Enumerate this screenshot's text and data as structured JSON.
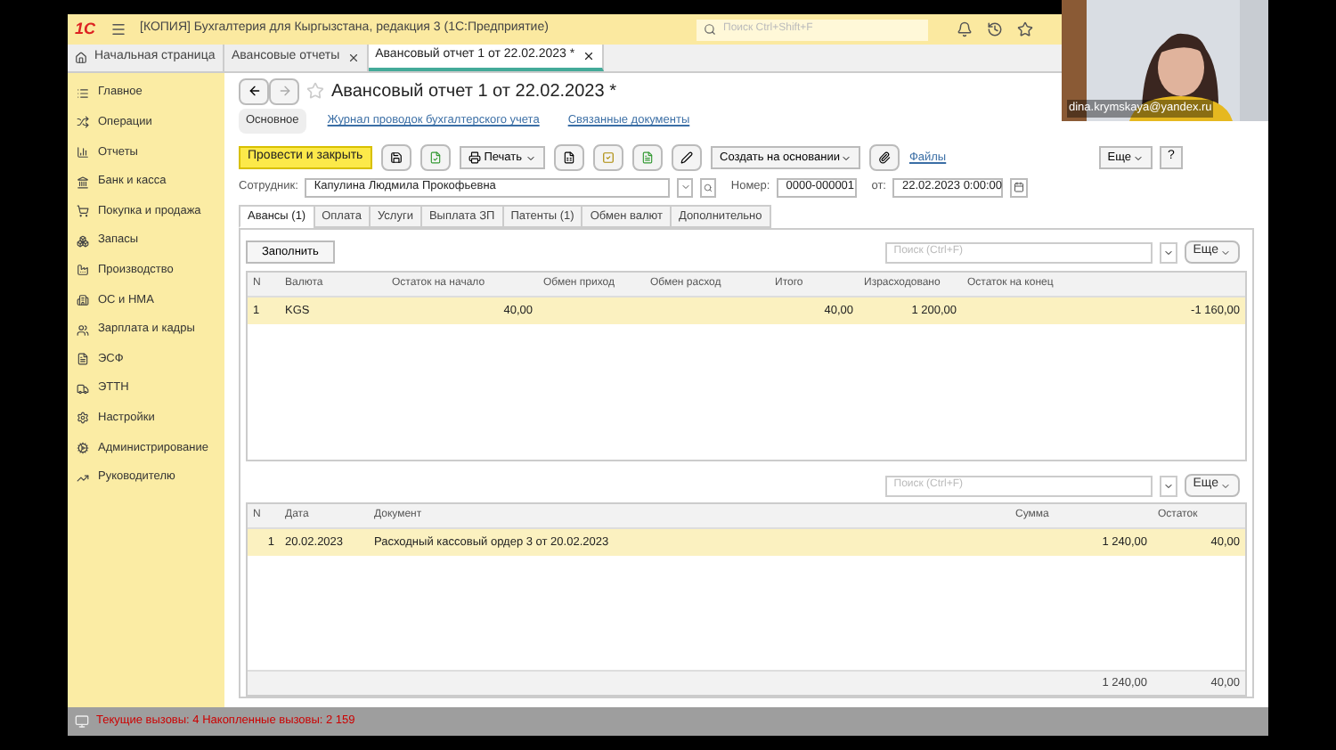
{
  "title_bar": {
    "logo": "1С",
    "title": "[КОПИЯ] Бухгалтерия для Кыргызстана, редакция 3  (1С:Предприятие)",
    "search": {
      "placeholder": "Поиск Ctrl+Shift+F"
    }
  },
  "tabs": [
    {
      "label": "Начальная страница",
      "selected": false,
      "kind": "home"
    },
    {
      "label": "Авансовые отчеты",
      "selected": false,
      "kind": "doc"
    },
    {
      "label": "Авансовый отчет 1 от 22.02.2023 *",
      "selected": true,
      "kind": "doc"
    }
  ],
  "sidebar": {
    "items": [
      {
        "label": "Главное"
      },
      {
        "label": "Операции"
      },
      {
        "label": "Отчеты"
      },
      {
        "label": "Банк и касса"
      },
      {
        "label": "Покупка и продажа"
      },
      {
        "label": "Запасы"
      },
      {
        "label": "Производство"
      },
      {
        "label": "ОС и НМА"
      },
      {
        "label": "Зарплата и кадры"
      },
      {
        "label": "ЭСФ"
      },
      {
        "label": "ЭТТН"
      },
      {
        "label": "Настройки"
      },
      {
        "label": "Администрирование"
      },
      {
        "label": "Руководителю"
      }
    ]
  },
  "document": {
    "title": "Авансовый отчет 1 от 22.02.2023 *",
    "sections": [
      {
        "label": "Основное",
        "selected": true
      },
      {
        "label": "Журнал проводок бухгалтерского учета",
        "selected": false
      },
      {
        "label": "Связанные документы",
        "selected": false
      }
    ],
    "toolbar": {
      "post_close": "Провести и закрыть",
      "print": "Печать",
      "create_based": "Создать на основании",
      "files": "Файлы",
      "more": "Еще",
      "help": "?"
    },
    "fields": {
      "employee_label": "Сотрудник:",
      "employee": "Капулина Людмила Прокофьевна",
      "number_label": "Номер:",
      "number": "0000-000001",
      "date_label": "от:",
      "date": "22.02.2023  0:00:00"
    },
    "tabs": [
      {
        "label": "Авансы (1)",
        "selected": true
      },
      {
        "label": "Оплата",
        "selected": false
      },
      {
        "label": "Услуги",
        "selected": false
      },
      {
        "label": "Выплата ЗП",
        "selected": false
      },
      {
        "label": "Патенты (1)",
        "selected": false
      },
      {
        "label": "Обмен валют",
        "selected": false
      },
      {
        "label": "Дополнительно",
        "selected": false
      }
    ],
    "advances": {
      "fill_button": "Заполнить",
      "search": {
        "placeholder": "Поиск (Ctrl+F)"
      },
      "more": "Еще",
      "columns": [
        "N",
        "Валюта",
        "Остаток на начало",
        "Обмен приход",
        "Обмен расход",
        "Итого",
        "Израсходовано",
        "Остаток на конец"
      ],
      "rows": [
        {
          "selected": true,
          "cells": [
            "1",
            "KGS",
            "40,00",
            "",
            "",
            "40,00",
            "1 200,00",
            "-1 160,00"
          ]
        }
      ]
    },
    "payments": {
      "search": {
        "placeholder": "Поиск (Ctrl+F)"
      },
      "more": "Еще",
      "columns": [
        "N",
        "Дата",
        "Документ",
        "Сумма",
        "Остаток"
      ],
      "rows": [
        {
          "selected": true,
          "cells": [
            "1",
            "20.02.2023",
            "Расходный кассовый ордер 3 от 20.02.2023",
            "1 240,00",
            "40,00"
          ]
        }
      ],
      "totals": {
        "sum": "1 240,00",
        "balance": "40,00"
      }
    }
  },
  "status_bar": {
    "text": "Текущие вызовы: 4   Накопленные вызовы: 2 159"
  },
  "webcam": {
    "kind": "picture",
    "caption": "dina.krymskaya@yandex.ru"
  }
}
